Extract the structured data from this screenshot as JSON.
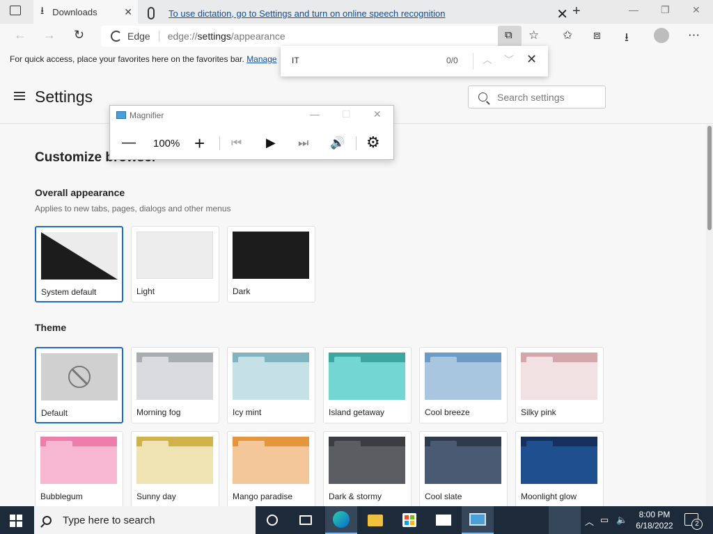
{
  "browser": {
    "tab_title": "Downloads",
    "dictation_message": "To use dictation, go to Settings and turn on online speech recognition",
    "omnibox_site": "Edge",
    "url_prefix": "edge://",
    "url_host": "settings",
    "url_path": "/appearance",
    "favorites_message": "For quick access, place your favorites here on the favorites bar.",
    "favorites_manage": "Manage"
  },
  "find": {
    "query": "IT",
    "count": "0/0"
  },
  "settings": {
    "title": "Settings",
    "search_placeholder": "Search settings",
    "section_title": "Customize browser",
    "overall_title": "Overall appearance",
    "overall_sub": "Applies to new tabs, pages, dialogs and other menus",
    "appearance_options": [
      "System default",
      "Light",
      "Dark"
    ],
    "theme_title": "Theme",
    "themes": [
      {
        "label": "Default",
        "top": "#d0d0d0",
        "body": "#d0d0d0",
        "tab": "#d0d0d0"
      },
      {
        "label": "Morning fog",
        "top": "#a8adb2",
        "body": "#d9dbde",
        "tab": "#d9dbde"
      },
      {
        "label": "Icy mint",
        "top": "#7fb5c1",
        "body": "#c6e1e6",
        "tab": "#c6e1e6"
      },
      {
        "label": "Island getaway",
        "top": "#3ea6a1",
        "body": "#73d6d3",
        "tab": "#73d6d3"
      },
      {
        "label": "Cool breeze",
        "top": "#6d9bc6",
        "body": "#a9c6e1",
        "tab": "#a9c6e1"
      },
      {
        "label": "Silky pink",
        "top": "#d6a7aa",
        "body": "#f2e1e2",
        "tab": "#f2e1e2"
      },
      {
        "label": "Bubblegum",
        "top": "#ee7dac",
        "body": "#f8b7d1",
        "tab": "#f8b7d1"
      },
      {
        "label": "Sunny day",
        "top": "#cfb34a",
        "body": "#efe3b3",
        "tab": "#efe3b3"
      },
      {
        "label": "Mango paradise",
        "top": "#e5953d",
        "body": "#f3c79a",
        "tab": "#f3c79a"
      },
      {
        "label": "Dark & stormy",
        "top": "#3b3d42",
        "body": "#5b5d62",
        "tab": "#5b5d62"
      },
      {
        "label": "Cool slate",
        "top": "#2f3b4d",
        "body": "#4a5a72",
        "tab": "#4a5a72"
      },
      {
        "label": "Moonlight glow",
        "top": "#15305a",
        "body": "#1f4f8f",
        "tab": "#1f4f8f"
      }
    ]
  },
  "magnifier": {
    "title": "Magnifier",
    "zoom": "100%"
  },
  "taskbar": {
    "search_placeholder": "Type here to search",
    "time": "8:00 PM",
    "date": "6/18/2022",
    "notification_count": "2"
  }
}
